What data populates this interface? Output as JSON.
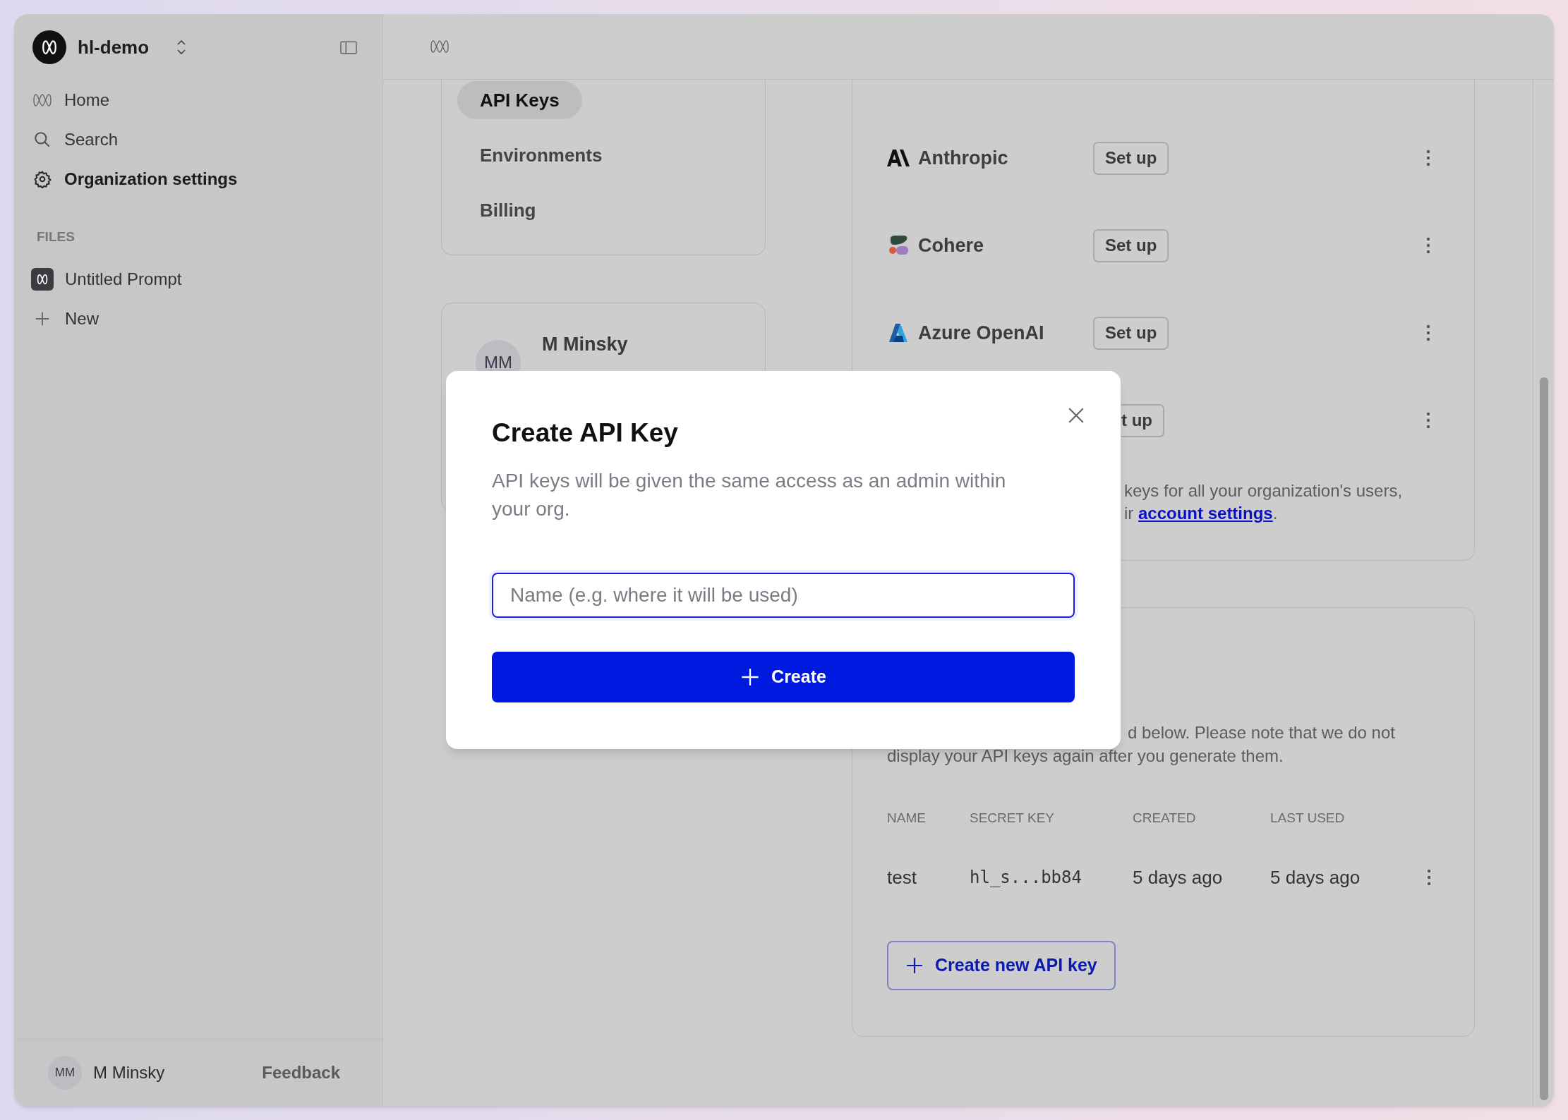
{
  "sidebar": {
    "workspace": "hl-demo",
    "nav": [
      {
        "label": "Home",
        "selected": false
      },
      {
        "label": "Search",
        "selected": false
      },
      {
        "label": "Organization settings",
        "selected": true
      }
    ],
    "files_heading": "FILES",
    "files": [
      {
        "label": "Untitled Prompt",
        "kind": "file"
      },
      {
        "label": "New",
        "kind": "new"
      }
    ],
    "user": {
      "initials": "MM",
      "name": "M Minsky"
    },
    "feedback": "Feedback"
  },
  "settings_nav": [
    {
      "label": "API Keys",
      "selected": true
    },
    {
      "label": "Environments",
      "selected": false
    },
    {
      "label": "Billing",
      "selected": false
    }
  ],
  "profile": {
    "initials": "MM",
    "name": "M Minsky"
  },
  "providers": [
    {
      "name": "Anthropic",
      "action": "Set up"
    },
    {
      "name": "Cohere",
      "action": "Set up"
    },
    {
      "name": "Azure OpenAI",
      "action": "Set up"
    },
    {
      "action": "t up"
    }
  ],
  "providers_note": {
    "line_1": "keys for all your organization's users,",
    "line_2_prefix": "ir ",
    "link": "account settings",
    "line_2_suffix": "."
  },
  "api_keys": {
    "note_line_1": "d below. Please note that we do not",
    "note_line_2": "display your API keys again after you generate them.",
    "columns": [
      "NAME",
      "SECRET KEY",
      "CREATED",
      "LAST USED"
    ],
    "rows": [
      {
        "name": "test",
        "secret_key": "hl_s...bb84",
        "created": "5 days ago",
        "last_used": "5 days ago"
      }
    ],
    "create_button": "Create new API key"
  },
  "dialog": {
    "title": "Create API Key",
    "description": "API keys will be given the same access as an admin within your org.",
    "name_field": {
      "placeholder": "Name (e.g. where it will be used)"
    },
    "submit": "Create"
  }
}
